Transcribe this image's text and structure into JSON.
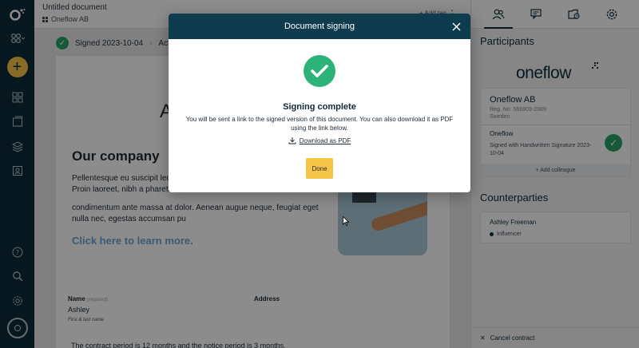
{
  "document": {
    "title": "Untitled document",
    "org": "Oneflow AB",
    "add_tag": "+ Add tag",
    "status_label": "Signed 2023-10-04",
    "next_step": "Act"
  },
  "content": {
    "letter": "A",
    "heading": "Our company",
    "para1": "Pellentesque eu suscipit leo. Aliquam erat volutpat. Donec et efficitur a. Proin laoreet, nibh a pharetra convallis, nisi",
    "para2": "condimentum ante massa at dolor. Aenean augue neque, feugiat eget nulla nec, egestas accumsan pu",
    "learn_more": "Click here to learn more.",
    "name_label": "Name",
    "name_required": "(required)",
    "name_value": "Ashley",
    "name_hint": "First & last name",
    "address_label": "Address",
    "contract_period": "The contract period is 12 months and the notice period is 3 months."
  },
  "panel": {
    "participants_heading": "Participants",
    "brand": "oneflow",
    "org_name": "Oneflow AB",
    "reg_no": "Reg. No: 556903-2989",
    "country": "Sweden",
    "participant_name": "Oneflow",
    "signed_with": "Signed with Handwritten Signature 2023-10-04",
    "add_colleague": "+ Add colleague",
    "counterparties_heading": "Counterparties",
    "counterparty_name": "Ashley Freeman",
    "counterparty_role": "Influencer",
    "cancel": "Cancel contract"
  },
  "modal": {
    "title": "Document signing",
    "heading": "Signing complete",
    "message": "You will be sent a link to the signed version of this document. You can also download it as PDF using the link below.",
    "download": "Download as PDF",
    "done": "Done"
  },
  "colors": {
    "rail": "#0e2a3b",
    "modal_header": "#0e3c4e",
    "success": "#2db37a",
    "accent_yellow": "#f6c446"
  }
}
